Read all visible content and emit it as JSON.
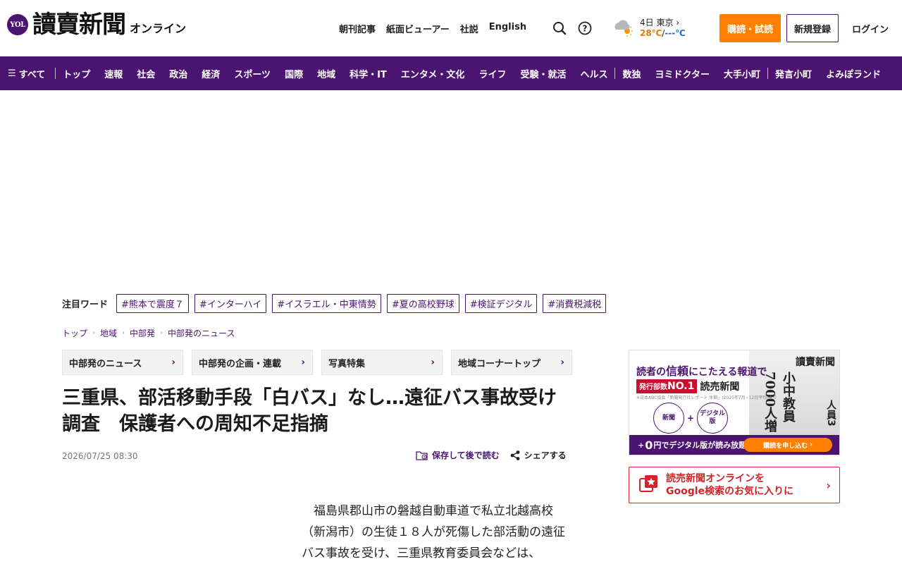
{
  "header": {
    "logo_badge": "YOL",
    "logo_text": "讀賣新聞",
    "logo_sub": "オンライン",
    "links": [
      "朝刊記事",
      "紙面ビューアー",
      "社説",
      "English"
    ],
    "weather": {
      "day_city": "4日 東京",
      "temp_high": "28℃",
      "sep": "/",
      "temp_low": "---℃"
    },
    "subscribe": "購読・試読",
    "register": "新規登録",
    "login": "ログイン"
  },
  "nav": {
    "all": "すべて",
    "items": [
      "トップ",
      "速報",
      "社会",
      "政治",
      "経済",
      "スポーツ",
      "国際",
      "地域",
      "科学・IT",
      "エンタメ・文化",
      "ライフ",
      "受験・就活",
      "ヘルス"
    ],
    "items2": [
      "数独",
      "ヨミドクター",
      "大手小町"
    ],
    "items3": [
      "発言小町",
      "よみぽランド"
    ]
  },
  "trending": {
    "label": "注目ワード",
    "tags": [
      "#熊本で震度７",
      "#インターハイ",
      "#イスラエル・中東情勢",
      "#夏の高校野球",
      "#検証デジタル",
      "#消費税減税"
    ]
  },
  "breadcrumb": [
    "トップ",
    "地域",
    "中部発",
    "中部発のニュース"
  ],
  "sections": [
    "中部発のニュース",
    "中部発の企画・連載",
    "写真特集",
    "地域コーナートップ"
  ],
  "article": {
    "title": "三重県、部活移動手段「白バス」なし…遠征バス事故受け調査　保護者への周知不足指摘",
    "date": "2026/07/25 08:30",
    "save": "保存して後で読む",
    "share": "シェアする",
    "body": "福島県郡山市の磐越自動車道で私立北越高校（新潟市）の生徒１８人が死傷した部活動の遠征バス事故を受け、三重県教育委員会などは、"
  },
  "sidebar": {
    "ad": {
      "tagline_pre": "読者の",
      "tagline_strong": "信頼",
      "tagline_post": "にこたえる報道で",
      "badge_pre": "発行部数",
      "badge_strong": "NO.1",
      "paper_name": "読売新聞",
      "fine": "※日本ABC協会「新聞発行社レポート 半期」(2025年7月~12月平均)より",
      "circle1": "新聞",
      "circle_plus": "+",
      "circle2": "デジタル版",
      "bar_pre": "+",
      "bar_zero": "0",
      "bar_post": "円でデジタル版が読み放題!",
      "cta": "購読を申し込む",
      "masthead": "讀賣新聞",
      "head1": "小中教員7000人増",
      "head2": "人員3"
    },
    "google": {
      "line1": "読売新聞オンラインを",
      "line2": "Google検索のお気に入りに"
    }
  },
  "colors": {
    "brand_purple": "#4b1471",
    "subscribe_orange": "#ff7f00",
    "google_red": "#d0242a"
  }
}
